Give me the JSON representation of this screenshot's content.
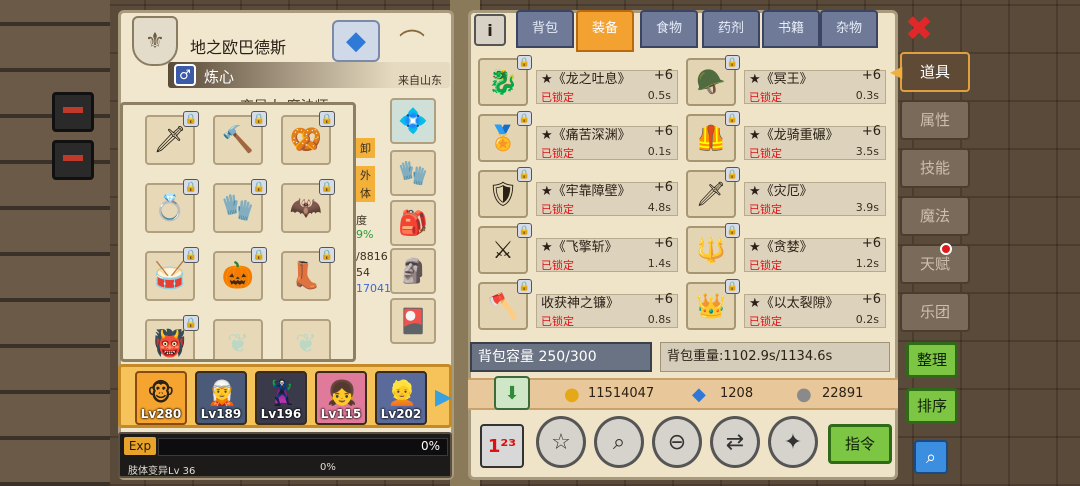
{
  "character": {
    "name": "地之欧巴德斯",
    "class_name": "炼心",
    "origin": "来自山东",
    "subclass": "变异人 魔法师",
    "stat_fragments": [
      "卸",
      "外",
      "体",
      "度",
      "9%",
      "/8816",
      "54",
      "17041"
    ]
  },
  "party": [
    {
      "level": "Lv280"
    },
    {
      "level": "Lv189"
    },
    {
      "level": "Lv196"
    },
    {
      "level": "Lv115"
    },
    {
      "level": "Lv202"
    }
  ],
  "exp": {
    "tag": "Exp",
    "percent": "0%",
    "sub_label": "肢体变异Lv 36",
    "sub_percent": "0%"
  },
  "tabs": [
    "背包",
    "装备",
    "食物",
    "药剂",
    "书籍",
    "杂物"
  ],
  "active_tab": "装备",
  "items": [
    {
      "name": "★《龙之吐息》",
      "plus": "+6",
      "locked": "已锁定",
      "time": "0.5s",
      "icon": "dragon-helm-icon"
    },
    {
      "name": "★《冥王》",
      "plus": "+6",
      "locked": "已锁定",
      "time": "0.3s",
      "icon": "dark-helm-icon"
    },
    {
      "name": "★《痛苦深渊》",
      "plus": "+6",
      "locked": "已锁定",
      "time": "0.1s",
      "icon": "amulet-icon"
    },
    {
      "name": "★《龙骑重碾》",
      "plus": "+6",
      "locked": "已锁定",
      "time": "3.5s",
      "icon": "armor-icon"
    },
    {
      "name": "★《牢靠障壁》",
      "plus": "+6",
      "locked": "已锁定",
      "time": "4.8s",
      "icon": "shield-armor-icon"
    },
    {
      "name": "★《灾厄》",
      "plus": "",
      "locked": "已锁定",
      "time": "3.9s",
      "icon": "dark-sword-icon"
    },
    {
      "name": "★《飞擎斩》",
      "plus": "+6",
      "locked": "已锁定",
      "time": "1.4s",
      "icon": "green-sword-icon"
    },
    {
      "name": "★《贪婪》",
      "plus": "+6",
      "locked": "已锁定",
      "time": "1.2s",
      "icon": "red-spear-icon"
    },
    {
      "name": "收获神之镰》",
      "plus": "+6",
      "locked": "已锁定",
      "time": "0.8s",
      "icon": "scythe-icon"
    },
    {
      "name": "★《以太裂隙》",
      "plus": "+6",
      "locked": "已锁定",
      "time": "0.2s",
      "icon": "purple-crown-icon"
    }
  ],
  "capacity": "背包容量 250/300",
  "weight": "背包重量:1102.9s/1134.6s",
  "currency": {
    "gold": "11514047",
    "gems": "1208",
    "silver": "22891"
  },
  "buttons": {
    "command": "指令",
    "organize": "整理",
    "sort": "排序"
  },
  "side_tabs": [
    "道具",
    "属性",
    "技能",
    "魔法",
    "天赋",
    "乐团"
  ],
  "active_side_tab": "道具"
}
